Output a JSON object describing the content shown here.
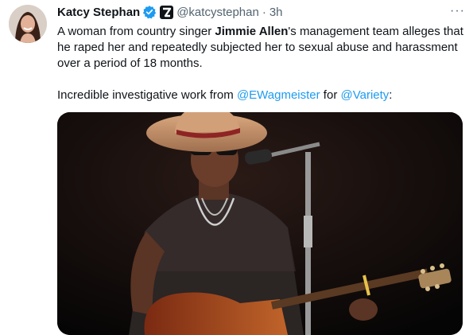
{
  "tweet": {
    "author": {
      "name": "Katcy Stephan",
      "handle": "@katcystephan",
      "separator": "·",
      "time": "3h",
      "avatar_icon": "profile-photo",
      "verified_icon": "verified-badge-icon",
      "affiliate_icon": "affiliate-badge-icon"
    },
    "more_label": "···",
    "paragraph1": {
      "pre": "A woman from country singer ",
      "bold": "Jimmie Allen",
      "post": "'s management team alleges that he raped her and repeatedly subjected her to sexual abuse and harassment over a period of 18 months."
    },
    "paragraph2": {
      "pre": "Incredible investigative work from ",
      "mention1": "@EWagmeister",
      "mid": " for ",
      "mention2": "@Variety",
      "post": ":"
    },
    "colors": {
      "link": "#1d9bf0",
      "verified": "#1d9bf0",
      "text": "#0f1419",
      "secondary": "#536471"
    }
  }
}
